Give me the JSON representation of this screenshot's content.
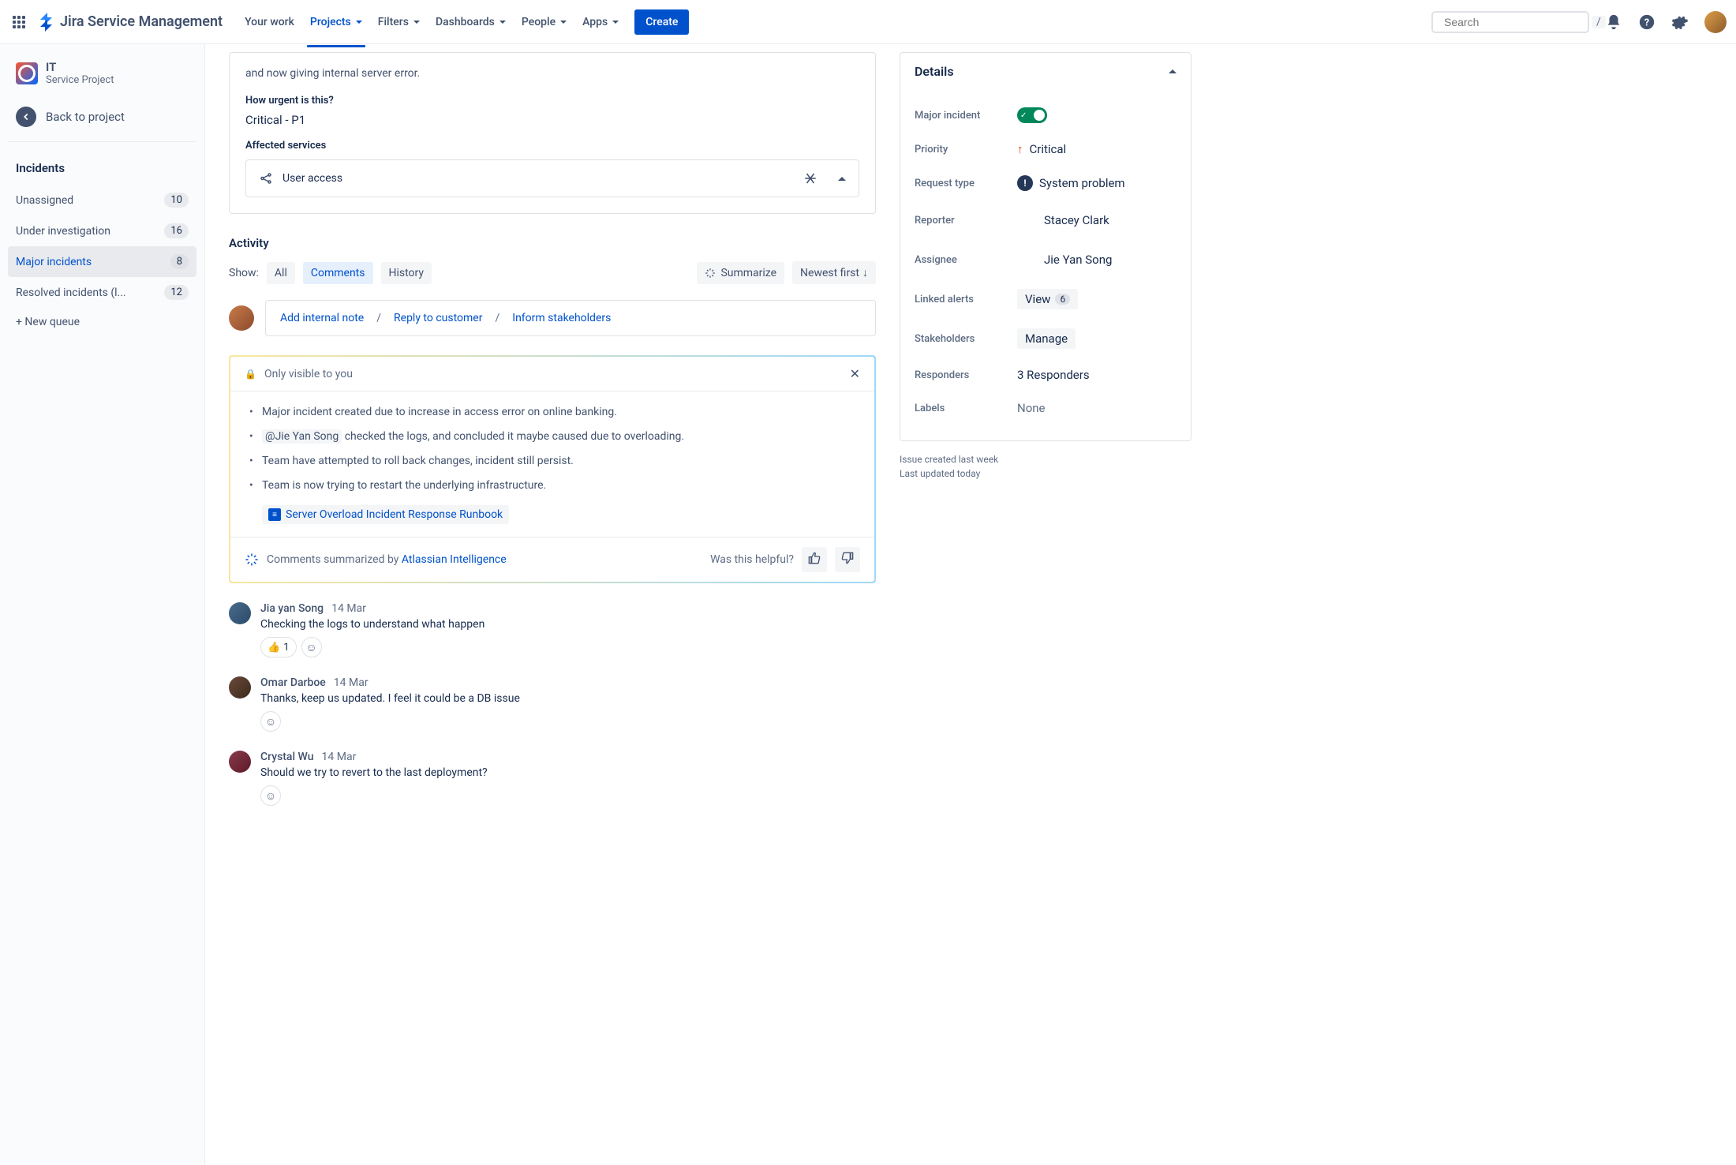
{
  "nav": {
    "product": "Jira Service Management",
    "items": [
      "Your work",
      "Projects",
      "Filters",
      "Dashboards",
      "People",
      "Apps"
    ],
    "create": "Create",
    "search_placeholder": "Search",
    "slash": "/"
  },
  "sidebar": {
    "project_key": "IT",
    "project_type": "Service Project",
    "back": "Back to project",
    "heading": "Incidents",
    "queues": [
      {
        "label": "Unassigned",
        "count": "10",
        "active": false
      },
      {
        "label": "Under investigation",
        "count": "16",
        "active": false
      },
      {
        "label": "Major incidents",
        "count": "8",
        "active": true
      },
      {
        "label": "Resolved incidents (l...",
        "count": "12",
        "active": false
      }
    ],
    "new_queue": "+ New queue"
  },
  "ticket": {
    "desc_suffix": "and now giving internal server error.",
    "urgent_q": "How urgent is this?",
    "urgent_a": "Critical - P1",
    "affected_q": "Affected services",
    "affected_service": "User access"
  },
  "activity": {
    "heading": "Activity",
    "show": "Show:",
    "tabs": [
      "All",
      "Comments",
      "History"
    ],
    "summarize": "Summarize",
    "sort": "Newest first",
    "composer": {
      "internal": "Add internal note",
      "reply": "Reply to customer",
      "inform": "Inform stakeholders"
    }
  },
  "ai": {
    "visibility": "Only visible to you",
    "bullets": [
      "Major incident created due to increase in access error on online banking.",
      " checked the logs, and concluded it maybe caused due to overloading.",
      "Team have attempted to roll back changes, incident still persist.",
      "Team is now trying to restart the underlying infrastructure."
    ],
    "mention": "@Jie Yan Song",
    "runbook": "Server Overload Incident Response Runbook",
    "footer_prefix": "Comments summarized by ",
    "footer_link": "Atlassian Intelligence",
    "helpful": "Was this helpful?"
  },
  "comments": [
    {
      "author": "Jia yan Song",
      "date": "14 Mar",
      "text": "Checking the logs to understand what happen",
      "reaction": "👍",
      "reaction_count": "1"
    },
    {
      "author": "Omar Darboe",
      "date": "14 Mar",
      "text": "Thanks, keep us updated. I feel it could be a DB issue"
    },
    {
      "author": "Crystal Wu",
      "date": "14 Mar",
      "text": "Should we try to revert to the last deployment?"
    }
  ],
  "details": {
    "heading": "Details",
    "rows": {
      "major": "Major incident",
      "priority_label": "Priority",
      "priority_value": "Critical",
      "request_type_label": "Request type",
      "request_type_value": "System problem",
      "reporter_label": "Reporter",
      "reporter_value": "Stacey Clark",
      "assignee_label": "Assignee",
      "assignee_value": "Jie Yan Song",
      "linked_alerts_label": "Linked alerts",
      "linked_alerts_view": "View",
      "linked_alerts_count": "6",
      "stakeholders_label": "Stakeholders",
      "stakeholders_value": "Manage",
      "responders_label": "Responders",
      "responders_value": "3 Responders",
      "labels_label": "Labels",
      "labels_value": "None"
    },
    "created": "Issue created last week",
    "updated": "Last updated today"
  }
}
